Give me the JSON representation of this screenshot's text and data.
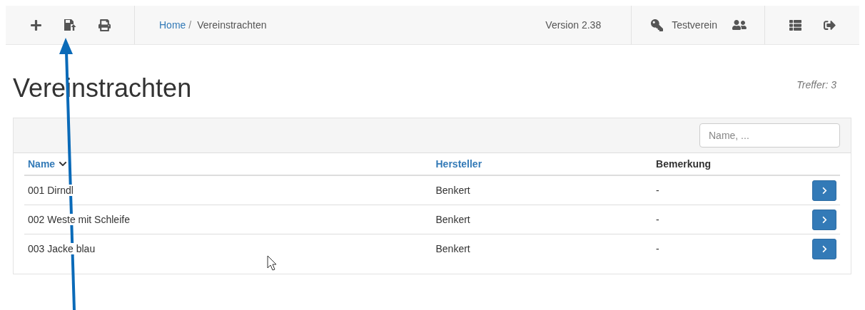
{
  "breadcrumb": [
    {
      "label": "Home",
      "kind": "link",
      "separator": "/"
    },
    {
      "label": "Vereinstrachten",
      "kind": "current"
    }
  ],
  "version": "Version 2.38",
  "user": "Testverein",
  "title": "Vereinstrachten",
  "hits": "Treffer: 3",
  "search": {
    "placeholder": "Name, ..."
  },
  "table": {
    "columns": [
      {
        "label": "Name",
        "kind": "link",
        "sorted": true
      },
      {
        "label": "Hersteller",
        "kind": "link",
        "sorted": false
      },
      {
        "label": "Bemerkung",
        "kind": "plain",
        "sorted": false
      }
    ],
    "rows": [
      [
        "001 Dirndl",
        "Benkert",
        "-"
      ],
      [
        "002 Weste mit Schleife",
        "Benkert",
        "-"
      ],
      [
        "003 Jacke blau",
        "Benkert",
        "-"
      ]
    ]
  }
}
